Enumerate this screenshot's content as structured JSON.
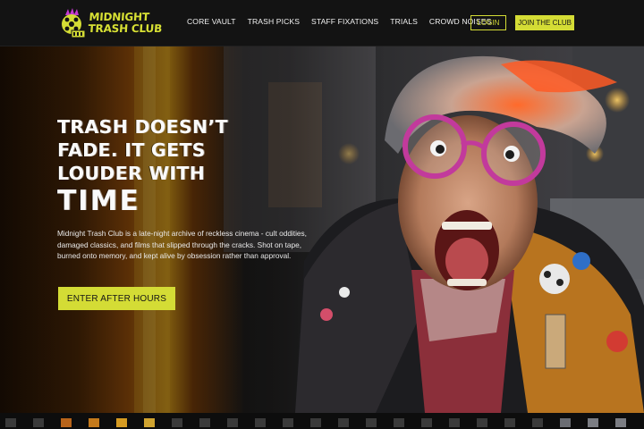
{
  "brand": {
    "line1": "MIDNIGHT",
    "line2": "TRASH CLUB",
    "accent_color": "#d4dc35"
  },
  "nav": {
    "items": [
      {
        "label": "CORE VAULT"
      },
      {
        "label": "TRASH PICKS"
      },
      {
        "label": "STAFF FIXATIONS"
      },
      {
        "label": "TRIALS"
      },
      {
        "label": "CROWD NOISES"
      }
    ],
    "login_label": "LOGIN",
    "join_label": "JOIN THE CLUB"
  },
  "hero": {
    "title_lines": [
      "TRASH DOESN’T",
      "FADE. IT GETS",
      "LOUDER WITH",
      "TIME"
    ],
    "description": "Midnight Trash Club is a late-night archive of reckless cinema - cult oddities, damaged classics, and films that slipped through the cracks. Shot on tape, burned onto memory, and kept alive by obsession rather than approval.",
    "cta_label": "ENTER AFTER HOURS"
  },
  "icons": {
    "logo": "film-reel-ghoul-icon"
  }
}
